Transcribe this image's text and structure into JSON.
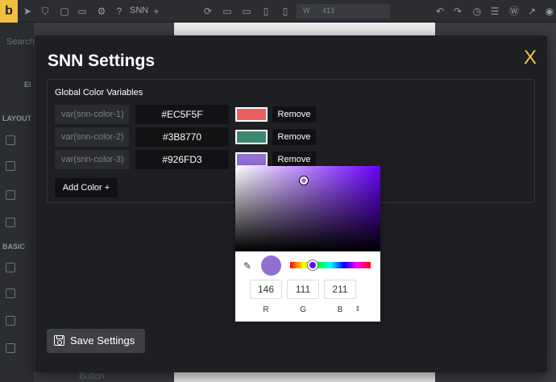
{
  "background": {
    "toolbar": {
      "logo": "b",
      "snn_label": "SNN",
      "width_value": "413"
    },
    "sidebar": {
      "search_placeholder": "Search",
      "section_layout": "LAYOUT",
      "section_basic": "BASIC",
      "element_partial": "El",
      "button_label": "Button"
    }
  },
  "modal": {
    "title": "SNN Settings",
    "close_label": "X",
    "panel_title": "Global Color Variables",
    "colors": [
      {
        "variable": "var(snn-color-1)",
        "hex": "#EC5F5F",
        "remove_label": "Remove"
      },
      {
        "variable": "var(snn-color-2)",
        "hex": "#3B8770",
        "remove_label": "Remove"
      },
      {
        "variable": "var(snn-color-3)",
        "hex": "#926FD3",
        "remove_label": "Remove"
      }
    ],
    "add_color_label": "Add Color +",
    "save_label": "Save Settings"
  },
  "picker": {
    "preview_color": "#926FD3",
    "rgb": {
      "r": "146",
      "g": "111",
      "b": "211"
    },
    "labels": {
      "r": "R",
      "g": "G",
      "b": "B"
    },
    "mode_toggle": "⇕"
  },
  "accent_colors": {
    "close": "#f5c542",
    "modal_bg": "#1e1f22"
  }
}
